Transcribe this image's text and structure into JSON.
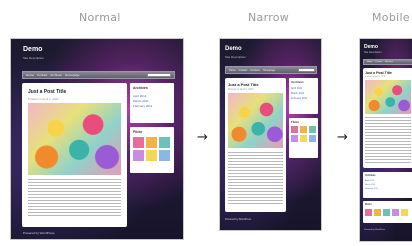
{
  "headings": {
    "normal": "Normal",
    "narrow": "Narrow",
    "mobile": "Mobile"
  },
  "arrow_glyph": "→",
  "site": {
    "title": "Demo",
    "tagline": "Site Description",
    "nav": [
      "Home",
      "Contact",
      "Archives",
      "Homepage"
    ],
    "post_title": "Just a Post Title",
    "post_meta": "Posted on April 1, 2011",
    "sidebar_title": "Archives",
    "archive_links": [
      "April 2011",
      "March 2011",
      "February 2011"
    ],
    "flickr_title": "Flickr",
    "footer": "Powered by WordPress"
  },
  "colors": {
    "background": "#ffffff",
    "heading_gray": "#9a9a9a",
    "space_purple": "#b23fb0",
    "space_dark": "#1b1a2e",
    "navbar": "#6e6e7c",
    "link_blue": "#4a66b0"
  },
  "thumb_colors": [
    "#e26f9d",
    "#f0b24a",
    "#6fc0b8",
    "#c88de0",
    "#f4d65a",
    "#8bb7e6"
  ]
}
